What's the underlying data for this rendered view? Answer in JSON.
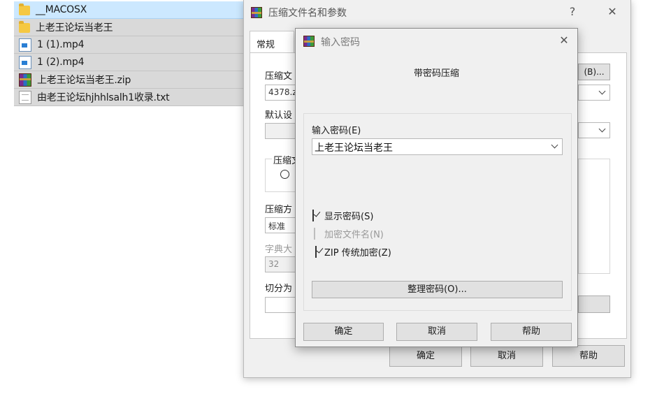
{
  "files": [
    {
      "name": "__MACOSX",
      "icon": "folder-icon",
      "selected": true
    },
    {
      "name": "上老王论坛当老王",
      "icon": "folder-icon",
      "selected": false
    },
    {
      "name": "1 (1).mp4",
      "icon": "video-file-icon",
      "selected": false
    },
    {
      "name": "1 (2).mp4",
      "icon": "video-file-icon",
      "selected": false
    },
    {
      "name": "上老王论坛当老王.zip",
      "icon": "archive-file-icon",
      "selected": false
    },
    {
      "name": "由老王论坛hjhhlsalh1收录.txt",
      "icon": "text-file-icon",
      "selected": false
    }
  ],
  "file_trailing_digit": "2",
  "main_window": {
    "title": "压缩文件名和参数",
    "help_glyph": "?",
    "close_glyph": "✕",
    "tab_general": "常规",
    "archive_name_label": "压缩文",
    "archive_name_value": "4378.z",
    "browse_button": "(B)...",
    "default_settings_label": "默认设",
    "format_group_label": "压缩文",
    "method_label": "压缩方",
    "method_value": "标准",
    "dict_label": "字典大",
    "dict_value": "32",
    "split_label": "切分为",
    "ok": "确定",
    "cancel": "取消",
    "help": "帮助"
  },
  "password_dialog": {
    "title": "输入密码",
    "close_glyph": "✕",
    "heading": "带密码压缩",
    "password_label": "输入密码(E)",
    "password_value": "上老王论坛当老王",
    "show_password": {
      "label": "显示密码(S)",
      "checked": true
    },
    "encrypt_filenames": {
      "label": "加密文件名(N)",
      "checked": false,
      "disabled": true
    },
    "zip_legacy": {
      "label": "ZIP 传统加密(Z)",
      "checked": true
    },
    "organize_button": "整理密码(O)...",
    "ok": "确定",
    "cancel": "取消",
    "help": "帮助"
  }
}
